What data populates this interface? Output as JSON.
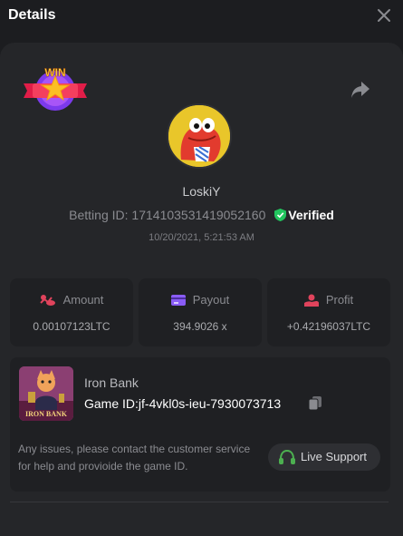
{
  "header": {
    "title": "Details",
    "close_icon": "close-icon"
  },
  "badge": {
    "text": "WIN"
  },
  "profile": {
    "username": "LoskiY",
    "betting_id_label": "Betting ID:",
    "betting_id": "1714103531419052160",
    "verified_label": "Verified",
    "timestamp": "10/20/2021, 5:21:53 AM"
  },
  "stats": [
    {
      "label": "Amount",
      "value": "0.00107123LTC",
      "icon": "coins-icon",
      "color": "#e0435c"
    },
    {
      "label": "Payout",
      "value": "394.9026 x",
      "icon": "card-icon",
      "color": "#8a5cf6"
    },
    {
      "label": "Profit",
      "value": "+0.42196037LTC",
      "icon": "hand-coin-icon",
      "color": "#e0435c"
    }
  ],
  "game": {
    "name": "Iron Bank",
    "id_label": "Game ID:",
    "id": "jf-4vkl0s-ieu-7930073713",
    "thumb_caption": "IRON BANK"
  },
  "support": {
    "issue_text": "Any issues, please contact the customer service for help and provioide the game ID.",
    "button_label": "Live Support",
    "accent": "#4caf50"
  }
}
